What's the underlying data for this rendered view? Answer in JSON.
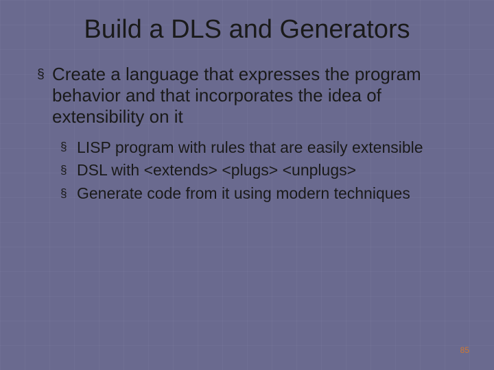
{
  "title": "Build a DLS and Generators",
  "points": {
    "main": "Create a language that expresses the program behavior and that incorporates the idea of extensibility on it",
    "subs": [
      "LISP program with rules that are easily extensible",
      "DSL with <extends> <plugs> <unplugs>",
      "Generate code from it using modern techniques"
    ]
  },
  "page_number": "85",
  "bullet_glyph": "§"
}
